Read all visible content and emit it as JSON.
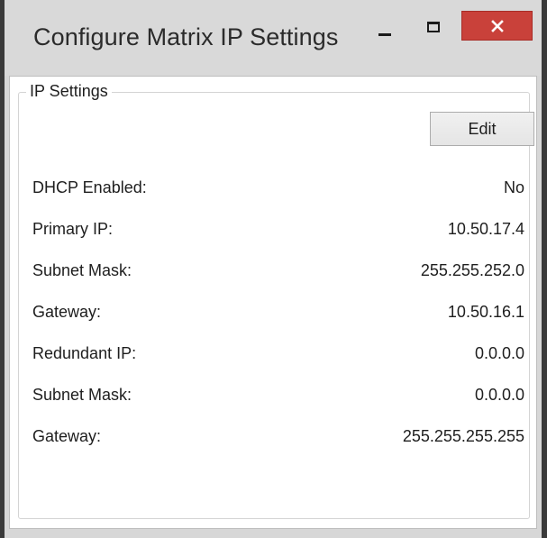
{
  "window": {
    "title": "Configure Matrix IP Settings"
  },
  "group": {
    "label": "IP Settings",
    "edit_label": "Edit"
  },
  "rows": [
    {
      "label": "DHCP Enabled:",
      "value": "No"
    },
    {
      "label": "Primary IP:",
      "value": "10.50.17.4"
    },
    {
      "label": "Subnet Mask:",
      "value": "255.255.252.0"
    },
    {
      "label": "Gateway:",
      "value": "10.50.16.1"
    },
    {
      "label": "Redundant IP:",
      "value": "0.0.0.0"
    },
    {
      "label": "Subnet Mask:",
      "value": "0.0.0.0"
    },
    {
      "label": "Gateway:",
      "value": "255.255.255.255"
    }
  ],
  "colors": {
    "close_button": "#c9413a",
    "titlebar": "#d9d9d9",
    "frame": "#3a3a3a"
  },
  "icons": [
    "minimize-icon",
    "maximize-icon",
    "close-icon"
  ]
}
